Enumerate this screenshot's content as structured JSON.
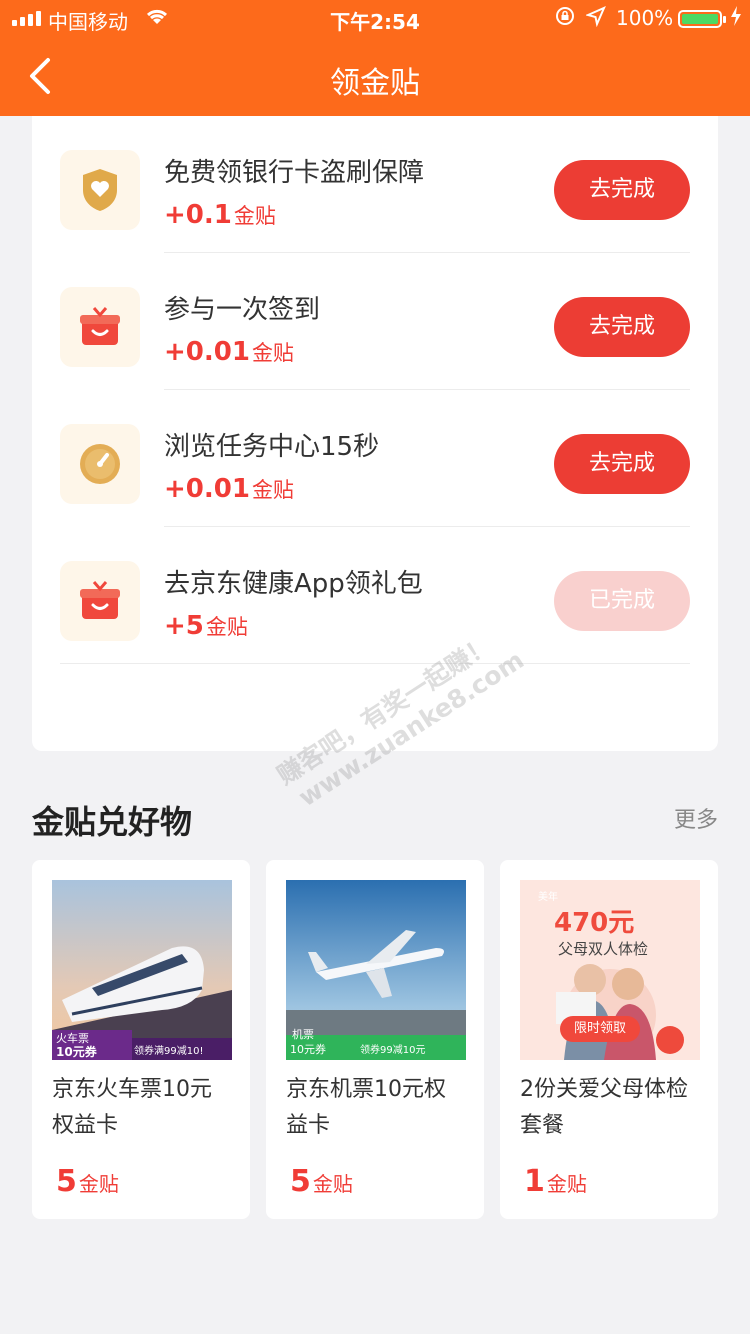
{
  "status_bar": {
    "carrier": "中国移动",
    "time": "下午2:54",
    "battery": "100%"
  },
  "header": {
    "title": "领金贴"
  },
  "tasks": [
    {
      "name": "免费领银行卡盗刷保障",
      "reward_num": "+0.1",
      "reward_unit": "金贴",
      "button": "去完成",
      "icon": "shield-heart-icon",
      "done": false
    },
    {
      "name": "参与一次签到",
      "reward_num": "+0.01",
      "reward_unit": "金贴",
      "button": "去完成",
      "icon": "gift-box-icon",
      "done": false
    },
    {
      "name": "浏览任务中心15秒",
      "reward_num": "+0.01",
      "reward_unit": "金贴",
      "button": "去完成",
      "icon": "timer-icon",
      "done": false
    },
    {
      "name": "去京东健康App领礼包",
      "reward_num": "+5",
      "reward_unit": "金贴",
      "button": "已完成",
      "icon": "gift-box-icon",
      "done": true
    }
  ],
  "watermark": {
    "line1": "赚客吧，有奖一起赚！",
    "line2": "www.zuanke8.com"
  },
  "section": {
    "title": "金贴兑好物",
    "more": "更多"
  },
  "goods": [
    {
      "name": "京东火车票10元权益卡",
      "price": "5",
      "unit": "金贴",
      "img_tag": "火车票",
      "img_coupon": "10元券",
      "img_banner": "领券满99减10!"
    },
    {
      "name": "京东机票10元权益卡",
      "price": "5",
      "unit": "金贴",
      "img_tag": "机票",
      "img_coupon": "10元券",
      "img_banner": "领券99减10元"
    },
    {
      "name": "2份关爱父母体检套餐",
      "price": "1",
      "unit": "金贴",
      "img_brand": "美年",
      "img_amount": "470元",
      "img_subtitle": "父母双人体检",
      "img_button": "限时领取"
    }
  ],
  "colors": {
    "brand_orange": "#fd6a1b",
    "accent_red": "#ec3d34",
    "done_pink": "#f9d0ce"
  }
}
